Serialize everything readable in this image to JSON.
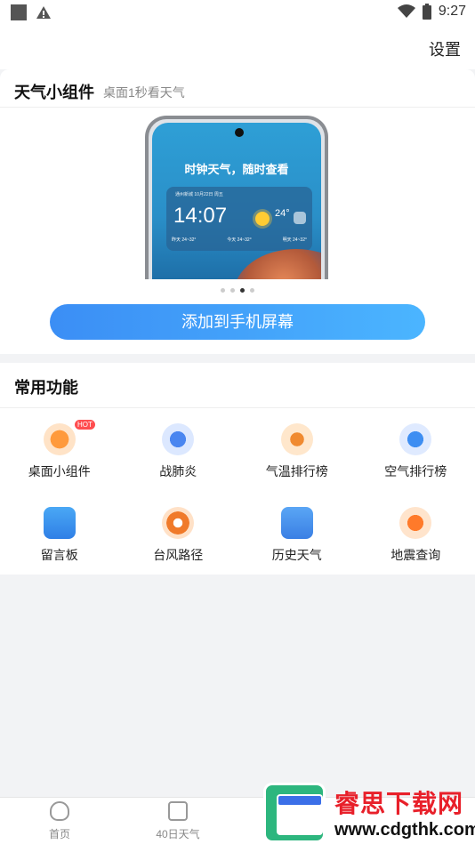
{
  "status_bar": {
    "time": "9:27",
    "icons": [
      "notification-square-icon",
      "warning-icon",
      "wifi-icon",
      "battery-icon"
    ]
  },
  "header": {
    "settings_label": "设置"
  },
  "widget_card": {
    "title": "天气小组件",
    "subtitle": "桌面1秒看天气",
    "preview": {
      "headline": "时钟天气，随时查看",
      "location": "通州新城 10月22日 周五",
      "time": "14:07",
      "temperature": "24°",
      "forecast": [
        "昨天 24~32°",
        "今天 24~32°",
        "明天 24~32°"
      ]
    },
    "carousel": {
      "count": 4,
      "active_index": 2
    },
    "add_button_label": "添加到手机屏幕"
  },
  "functions": {
    "title": "常用功能",
    "hot_badge": "HOT",
    "items": [
      {
        "label": "桌面小组件",
        "icon": "widget-icon",
        "hot": true
      },
      {
        "label": "战肺炎",
        "icon": "lung-icon"
      },
      {
        "label": "气温排行榜",
        "icon": "thermometer-icon"
      },
      {
        "label": "空气排行榜",
        "icon": "air-quality-icon"
      },
      {
        "label": "留言板",
        "icon": "message-board-icon"
      },
      {
        "label": "台风路径",
        "icon": "typhoon-icon"
      },
      {
        "label": "历史天气",
        "icon": "history-weather-icon"
      },
      {
        "label": "地震查询",
        "icon": "earthquake-icon"
      }
    ]
  },
  "tab_bar": {
    "tabs": [
      {
        "label": "首页",
        "icon": "home-icon"
      },
      {
        "label": "40日天气",
        "icon": "calendar-icon"
      }
    ]
  },
  "watermark": {
    "title": "睿思下载网",
    "url": "www.cdgthk.com"
  }
}
